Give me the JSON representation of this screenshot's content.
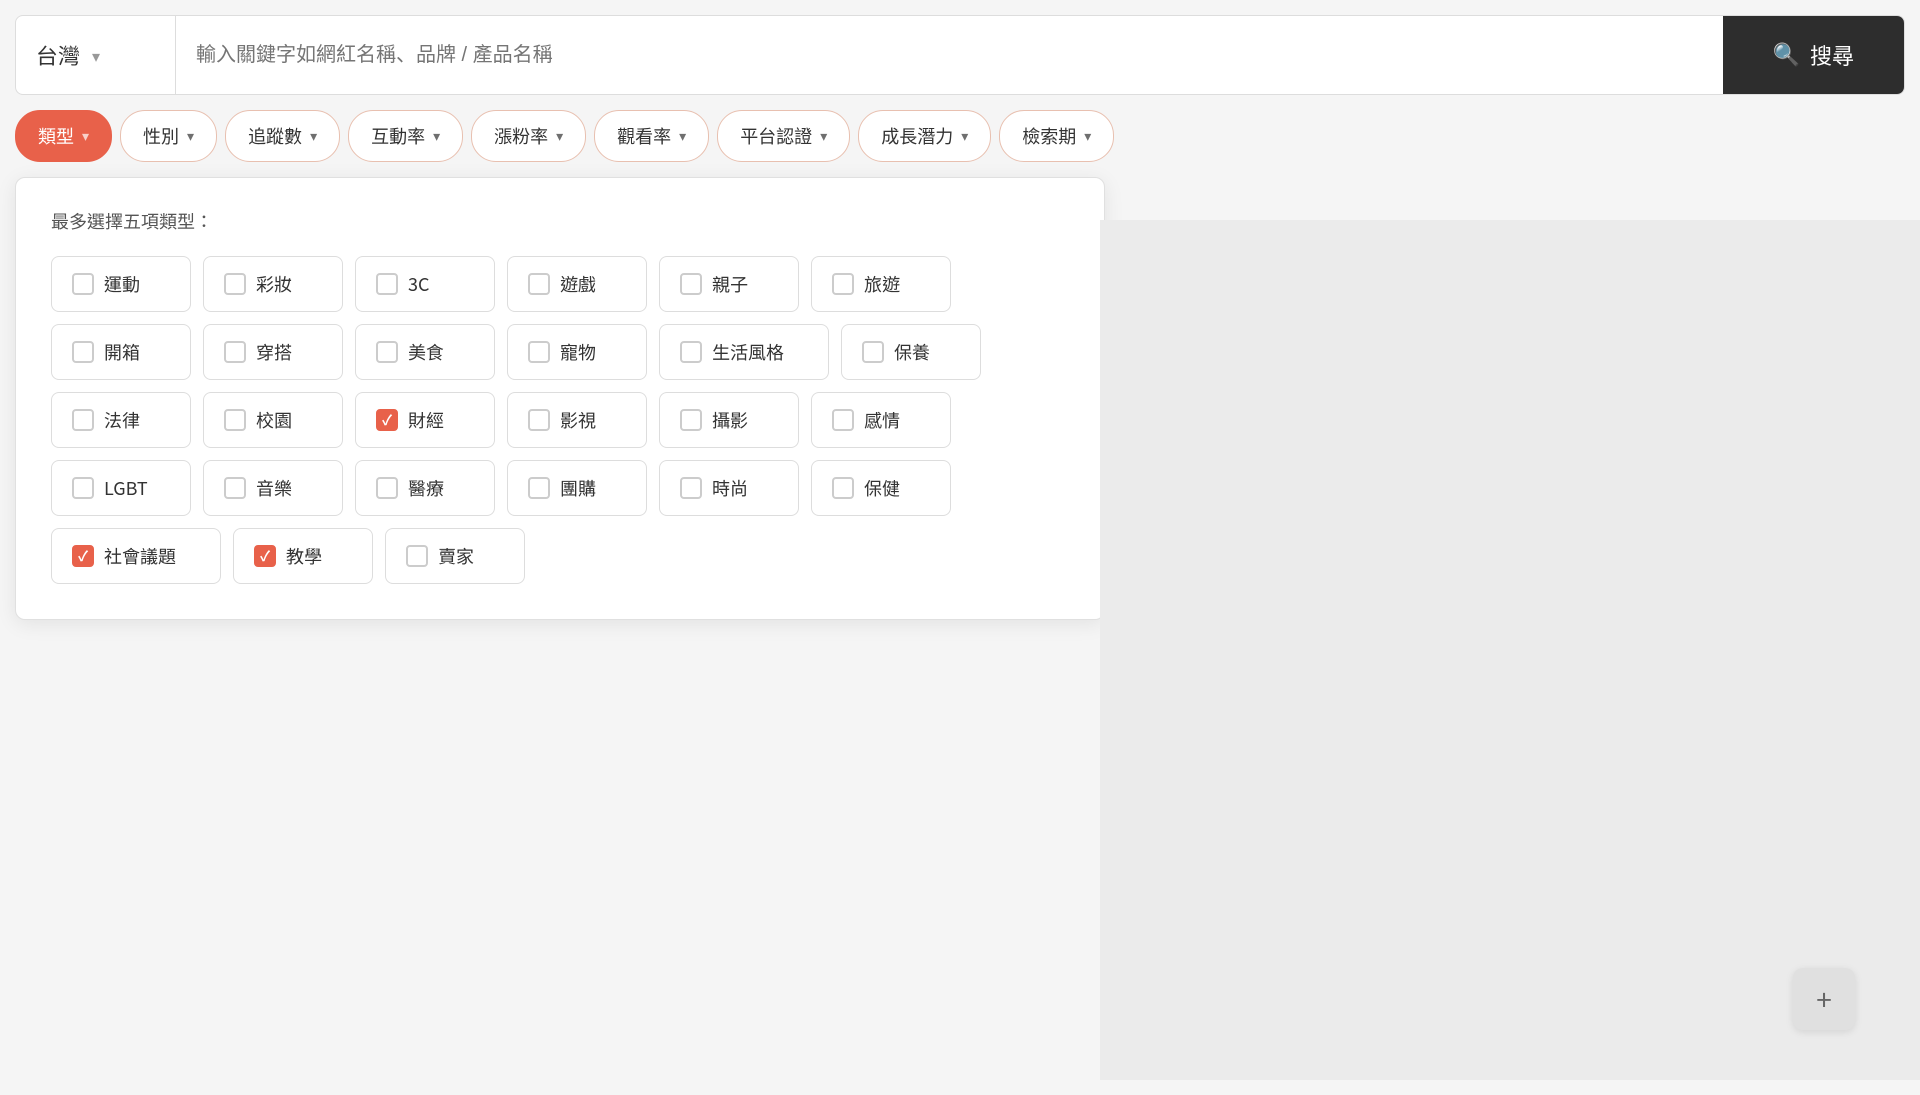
{
  "search": {
    "region": "台灣",
    "placeholder": "輸入關鍵字如網紅名稱、品牌 / 產品名稱",
    "button_label": "搜尋"
  },
  "filters": [
    {
      "id": "category",
      "label": "類型",
      "active": true
    },
    {
      "id": "gender",
      "label": "性別",
      "active": false
    },
    {
      "id": "followers",
      "label": "追蹤數",
      "active": false
    },
    {
      "id": "engagement",
      "label": "互動率",
      "active": false
    },
    {
      "id": "growth",
      "label": "漲粉率",
      "active": false
    },
    {
      "id": "views",
      "label": "觀看率",
      "active": false
    },
    {
      "id": "platform",
      "label": "平台認證",
      "active": false
    },
    {
      "id": "potential",
      "label": "成長潛力",
      "active": false
    },
    {
      "id": "search_rank",
      "label": "檢索期",
      "active": false
    }
  ],
  "dropdown": {
    "instruction": "最多選擇五項類型：",
    "categories": [
      [
        {
          "label": "運動",
          "checked": false
        },
        {
          "label": "彩妝",
          "checked": false
        },
        {
          "label": "3C",
          "checked": false
        },
        {
          "label": "遊戲",
          "checked": false
        },
        {
          "label": "親子",
          "checked": false
        },
        {
          "label": "旅遊",
          "checked": false
        }
      ],
      [
        {
          "label": "開箱",
          "checked": false
        },
        {
          "label": "穿搭",
          "checked": false
        },
        {
          "label": "美食",
          "checked": false
        },
        {
          "label": "寵物",
          "checked": false
        },
        {
          "label": "生活風格",
          "checked": false,
          "wide": true
        },
        {
          "label": "保養",
          "checked": false
        }
      ],
      [
        {
          "label": "法律",
          "checked": false
        },
        {
          "label": "校園",
          "checked": false
        },
        {
          "label": "財經",
          "checked": true
        },
        {
          "label": "影視",
          "checked": false
        },
        {
          "label": "攝影",
          "checked": false
        },
        {
          "label": "感情",
          "checked": false
        }
      ],
      [
        {
          "label": "LGBT",
          "checked": false
        },
        {
          "label": "音樂",
          "checked": false
        },
        {
          "label": "醫療",
          "checked": false
        },
        {
          "label": "團購",
          "checked": false
        },
        {
          "label": "時尚",
          "checked": false
        },
        {
          "label": "保健",
          "checked": false
        }
      ],
      [
        {
          "label": "社會議題",
          "checked": true,
          "wide": true
        },
        {
          "label": "教學",
          "checked": true
        },
        {
          "label": "賣家",
          "checked": false
        }
      ]
    ]
  },
  "plus_btn_label": "+"
}
